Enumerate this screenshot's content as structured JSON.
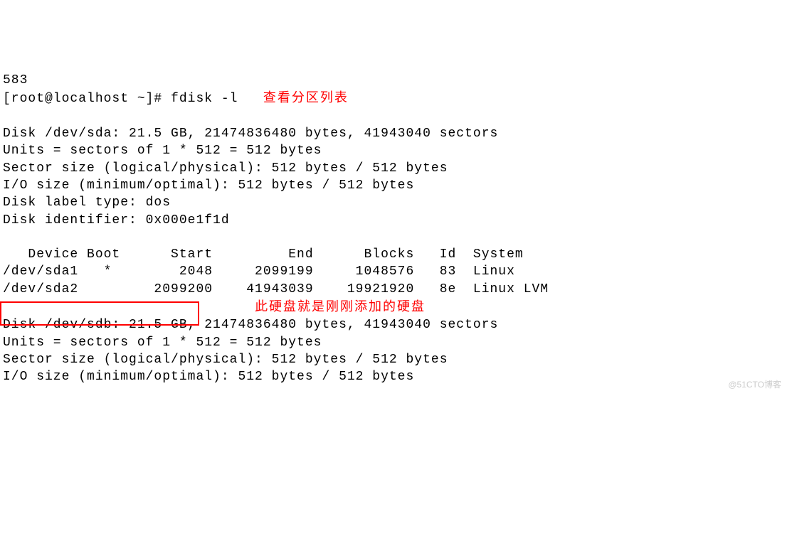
{
  "line_number": "583",
  "prompt": "[root@localhost ~]# ",
  "command": "fdisk -l",
  "annotation1": "查看分区列表",
  "annotation2": "此硬盘就是刚刚添加的硬盘",
  "disk_sda": {
    "header": "Disk /dev/sda: 21.5 GB, 21474836480 bytes, 41943040 sectors",
    "units": "Units = sectors of 1 * 512 = 512 bytes",
    "sector_size": "Sector size (logical/physical): 512 bytes / 512 bytes",
    "io_size": "I/O size (minimum/optimal): 512 bytes / 512 bytes",
    "label_type": "Disk label type: dos",
    "identifier": "Disk identifier: 0x000e1f1d"
  },
  "partition_header": "   Device Boot      Start         End      Blocks   Id  System",
  "partitions": [
    "/dev/sda1   *        2048     2099199     1048576   83  Linux",
    "/dev/sda2         2099200    41943039    19921920   8e  Linux LVM"
  ],
  "disk_sdb": {
    "header": "Disk /dev/sdb: 21.5 GB, 21474836480 bytes, 41943040 sectors",
    "units": "Units = sectors of 1 * 512 = 512 bytes",
    "sector_size": "Sector size (logical/physical): 512 bytes / 512 bytes",
    "io_size": "I/O size (minimum/optimal): 512 bytes / 512 bytes"
  },
  "watermark": "@51CTO博客"
}
